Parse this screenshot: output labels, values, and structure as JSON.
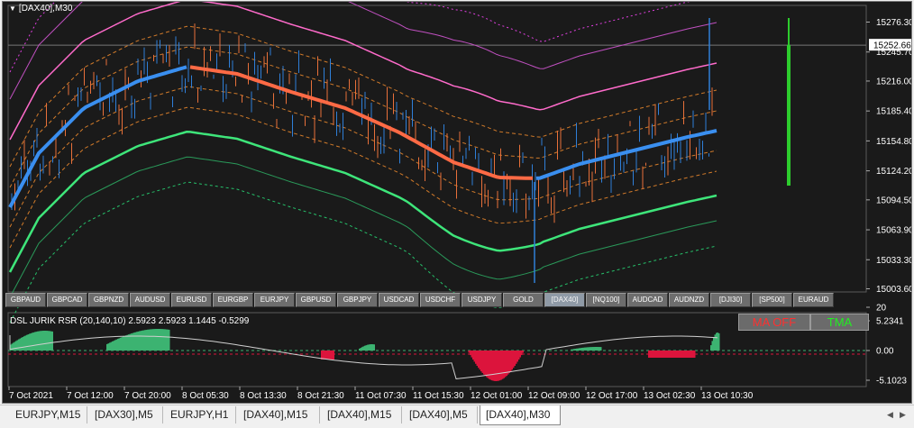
{
  "window_title": "[DAX40],M30",
  "indicator_title": "DSL JURIK RSR (20,140,10) 2.5923 2.5923 1.1445 -0.5299",
  "ma_button": "MA OFF",
  "tma_button": "TMA",
  "current_price": "15252.66",
  "price_ticks": [
    "15276.30",
    "15245.70",
    "15216.00",
    "15185.40",
    "15154.80",
    "15124.20",
    "15094.50",
    "15063.90",
    "15033.30",
    "15003.60"
  ],
  "indicator_ticks": [
    "20",
    "5.2341",
    "0.00",
    "-5.1023"
  ],
  "time_ticks": [
    "7 Oct 2021",
    "7 Oct 12:00",
    "7 Oct 20:00",
    "8 Oct 05:30",
    "8 Oct 13:30",
    "8 Oct 21:30",
    "11 Oct 07:30",
    "11 Oct 15:30",
    "12 Oct 01:00",
    "12 Oct 09:00",
    "12 Oct 17:00",
    "13 Oct 02:30",
    "13 Oct 10:30"
  ],
  "symbols": [
    {
      "label": "GBPAUD",
      "active": false
    },
    {
      "label": "GBPCAD",
      "active": false
    },
    {
      "label": "GBPNZD",
      "active": false
    },
    {
      "label": "AUDUSD",
      "active": false
    },
    {
      "label": "EURUSD",
      "active": false
    },
    {
      "label": "EURGBP",
      "active": false
    },
    {
      "label": "EURJPY",
      "active": false
    },
    {
      "label": "GBPUSD",
      "active": false
    },
    {
      "label": "GBPJPY",
      "active": false
    },
    {
      "label": "USDCAD",
      "active": false
    },
    {
      "label": "USDCHF",
      "active": false
    },
    {
      "label": "USDJPY",
      "active": false
    },
    {
      "label": "GOLD",
      "active": false
    },
    {
      "label": "[DAX40]",
      "active": true
    },
    {
      "label": "[NQ100]",
      "active": false
    },
    {
      "label": "AUDCAD",
      "active": false
    },
    {
      "label": "AUDNZD",
      "active": false
    },
    {
      "label": "[DJI30]",
      "active": false
    },
    {
      "label": "[SP500]",
      "active": false
    },
    {
      "label": "EURAUD",
      "active": false
    }
  ],
  "tabs": [
    {
      "label": "EURJPY,M15",
      "active": false
    },
    {
      "label": "[DAX30],M5",
      "active": false
    },
    {
      "label": "EURJPY,H1",
      "active": false
    },
    {
      "label": "[DAX40],M15",
      "active": false
    },
    {
      "label": "[DAX40],M15",
      "active": false
    },
    {
      "label": "[DAX40],M5",
      "active": false
    },
    {
      "label": "[DAX40],M30",
      "active": true
    }
  ],
  "colors": {
    "chart_bg": "#1a1a1a",
    "bull_candle": "#2f7fd8",
    "bear_candle": "#e8703a",
    "ma_up": "#3a8ff0",
    "ma_down": "#ff6a45",
    "upper_band": "#ff6bcb",
    "lower_band": "#3ee57a",
    "dashed_band": "#d07a2a",
    "hist_up": "#3cb371",
    "hist_down": "#dc143c",
    "volume_bar": "#2dcc2d"
  }
}
